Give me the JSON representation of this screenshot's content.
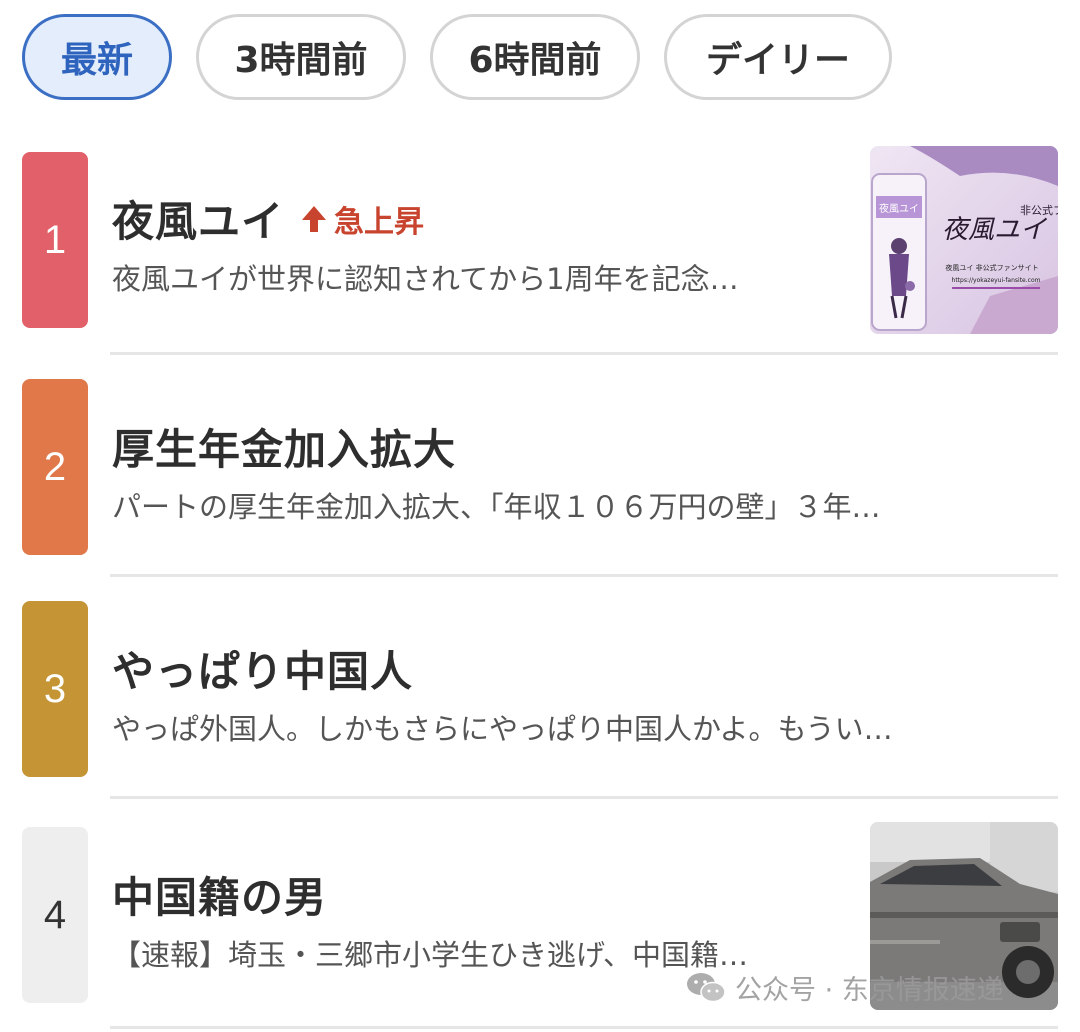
{
  "tabs": [
    {
      "label": "最新",
      "active": true
    },
    {
      "label": "3時間前",
      "active": false
    },
    {
      "label": "6時間前",
      "active": false
    },
    {
      "label": "デイリー",
      "active": false
    }
  ],
  "ranking": [
    {
      "rank": "1",
      "title": "夜風ユイ",
      "trend_label": "急上昇",
      "trend_icon": "up-arrow-icon",
      "desc": "夜風ユイが世界に認知されてから1周年を記念…",
      "badge_color": "#e2606a",
      "thumbnail": {
        "card_title": "夜風ユイ",
        "logo_text": "夜風ユイ",
        "side_text": "非公式ファンサイト",
        "caption": "夜風ユイ 非公式ファンサイト",
        "url": "https://yokazeyui-fansite.com"
      }
    },
    {
      "rank": "2",
      "title": "厚生年金加入拡大",
      "desc": "パートの厚生年金加入拡大、「年収１０６万円の壁」３年…",
      "badge_color": "#e0784a"
    },
    {
      "rank": "3",
      "title": "やっぱり中国人",
      "desc": "やっぱ外国人。しかもさらにやっぱり中国人かよ。もうい…",
      "badge_color": "#c49435"
    },
    {
      "rank": "4",
      "title": "中国籍の男",
      "desc": "【速報】埼玉・三郷市小学生ひき逃げ、中国籍…",
      "badge_color": "#eeeeee"
    }
  ],
  "watermark": {
    "text": "公众号 · 东京情报速递",
    "icon": "wechat-icon"
  }
}
